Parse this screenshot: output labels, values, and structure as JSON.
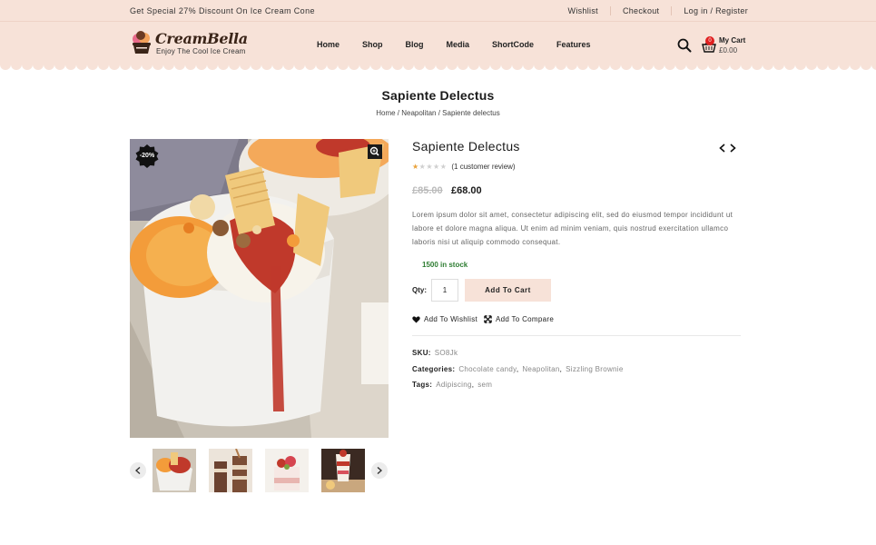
{
  "topbar": {
    "promo": "Get Special 27% Discount On Ice Cream Cone",
    "links": [
      "Wishlist",
      "Checkout",
      "Log in / Register"
    ]
  },
  "logo": {
    "name": "CreamBella",
    "tagline": "Enjoy The Cool Ice Cream"
  },
  "nav": [
    "Home",
    "Shop",
    "Blog",
    "Media",
    "ShortCode",
    "Features"
  ],
  "cart": {
    "count": "0",
    "label": "My Cart",
    "amount": "£0.00"
  },
  "page": {
    "title": "Sapiente Delectus",
    "breadcrumb": [
      "Home",
      "Neapolitan",
      "Sapiente delectus"
    ]
  },
  "product": {
    "sale_badge": "-20%",
    "title": "Sapiente Delectus",
    "rating": 1,
    "rating_max": 5,
    "review_text": "(1 customer review)",
    "price_old": "£85.00",
    "price_new": "£68.00",
    "description": "Lorem ipsum dolor sit amet, consectetur adipiscing elit, sed do eiusmod tempor incididunt ut labore et dolore magna aliqua. Ut enim ad minim veniam, quis nostrud exercitation ullamco laboris nisi ut aliquip commodo consequat.",
    "stock": "1500 in stock",
    "qty_label": "Qty:",
    "qty_value": "1",
    "add_to_cart": "Add To Cart",
    "add_to_wishlist": "Add To Wishlist",
    "add_to_compare": "Add To Compare",
    "sku_label": "SKU:",
    "sku": "SO8Jk",
    "categories_label": "Categories:",
    "categories": [
      "Chocolate candy",
      "Neapolitan",
      "Sizzling Brownie"
    ],
    "tags_label": "Tags:",
    "tags": [
      "Adipiscing",
      "sem"
    ]
  },
  "colors": {
    "header_bg": "#f7e2d8",
    "accent": "#f7e2d8",
    "stock_green": "#2e7d32",
    "star": "#e9a23b",
    "cart_badge": "#e02020"
  }
}
